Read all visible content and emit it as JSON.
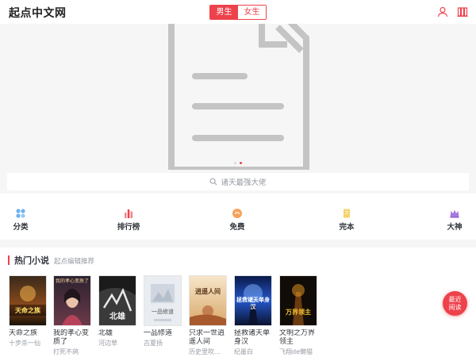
{
  "header": {
    "logo": "起点中文网",
    "gender_male": "男生",
    "gender_female": "女生",
    "icons": [
      "user-icon",
      "bookshelf-icon"
    ]
  },
  "banner": {
    "placeholder_icon": "document-icon",
    "dots": 2,
    "active_dot": 1
  },
  "search": {
    "placeholder": "诸天最强大佬"
  },
  "categories": [
    {
      "label": "分类",
      "icon": "grid-dots-icon"
    },
    {
      "label": "排行榜",
      "icon": "bar-chart-icon"
    },
    {
      "label": "免费",
      "icon": "free-badge-icon"
    },
    {
      "label": "完本",
      "icon": "book-icon"
    },
    {
      "label": "大神",
      "icon": "crown-icon"
    }
  ],
  "section": {
    "title": "热门小说",
    "subtitle": "起点编辑推荐"
  },
  "books": [
    {
      "title": "天命之族",
      "author": "十步杀一仙",
      "cover_text": "天命之族"
    },
    {
      "title": "我的孝心变质了",
      "author": "打死不鸽",
      "cover_text": "我的孝心变质了"
    },
    {
      "title": "北雄",
      "author": "河边草",
      "cover_text": "北雄"
    },
    {
      "title": "一品修道",
      "author": "古夏扬",
      "cover_text": "一品修道"
    },
    {
      "title": "只求一世逍遥人间",
      "author": "历史里吹...",
      "cover_text": "逍遥人间"
    },
    {
      "title": "拯救诸天单身汉",
      "author": "纪墨白",
      "cover_text": "拯救诸天单身汉"
    },
    {
      "title": "文明之万界领主",
      "author": "飞翔de懒猫",
      "cover_text": "万界领主"
    }
  ],
  "fab": {
    "label": "最近阅读"
  },
  "colors": {
    "accent": "#ed424b",
    "muted": "#969ba3",
    "text": "#33373d",
    "background": "#f6f6f6"
  }
}
